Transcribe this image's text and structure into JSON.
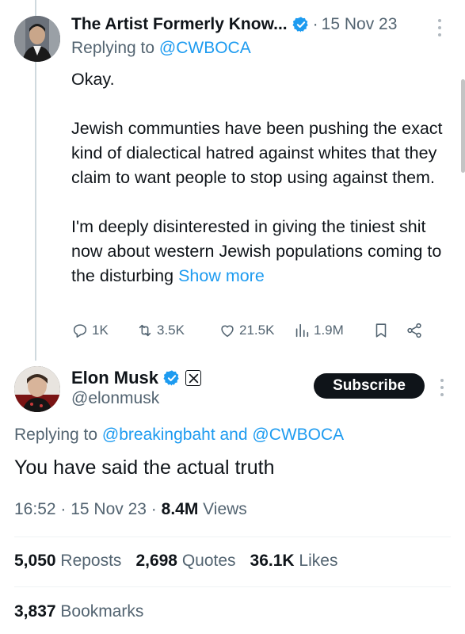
{
  "reply_tweet": {
    "author_name": "The Artist Formerly Know...",
    "separator": "·",
    "date": "15 Nov 23",
    "replying_prefix": "Replying to ",
    "replying_to": "@CWBOCA",
    "text": "Okay.\n\nJewish communties have been pushing the exact kind of dialectical hatred against whites that they claim to want people to stop using against them.\n\nI'm deeply disinterested in giving the tiniest shit now about western Jewish populations coming to the disturbing ",
    "show_more": "Show more",
    "replies": "1K",
    "reposts": "3.5K",
    "likes": "21.5K",
    "views": "1.9M",
    "icons": [
      "reply-icon",
      "repost-icon",
      "like-icon",
      "views-icon",
      "bookmark-icon",
      "share-icon"
    ]
  },
  "main_tweet": {
    "author_name": "Elon Musk",
    "handle": "@elonmusk",
    "subscribe_label": "Subscribe",
    "replying_prefix": "Replying to ",
    "replying_to_1": "@breakingbaht",
    "replying_and": " and ",
    "replying_to_2": "@CWBOCA",
    "text": "You have said the actual truth",
    "time": "16:52",
    "separator": " · ",
    "date": "15 Nov 23",
    "views_count": "8.4M",
    "views_label": " Views",
    "reposts_count": "5,050",
    "reposts_label": " Reposts",
    "quotes_count": "2,698",
    "quotes_label": " Quotes",
    "likes_count": "36.1K",
    "likes_label": " Likes",
    "bookmarks_count": "3,837",
    "bookmarks_label": " Bookmarks"
  },
  "colors": {
    "accent": "#1d9bf0",
    "secondary_text": "#536471",
    "primary_text": "#0f1419",
    "verified": "#1d9bf0"
  }
}
